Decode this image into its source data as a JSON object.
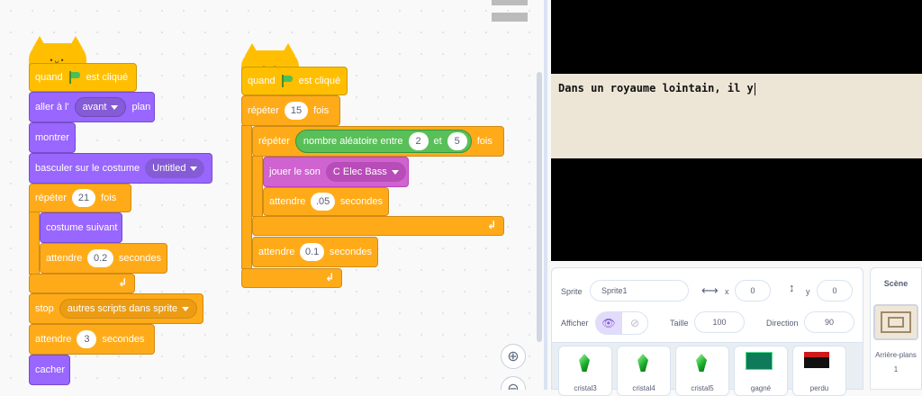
{
  "script1": {
    "hat_prefix": "quand",
    "hat_suffix": "est cliqué",
    "goto_prefix": "aller à l'",
    "goto_value": "avant",
    "goto_suffix": "plan",
    "show": "montrer",
    "switch_costume": "basculer sur le costume",
    "costume_value": "Untitled",
    "repeat_label": "répéter",
    "repeat_count": "21",
    "repeat_suffix": "fois",
    "next_costume": "costume suivant",
    "wait_label": "attendre",
    "wait_inner": "0.2",
    "wait_suffix": "secondes",
    "stop_label": "stop",
    "stop_value": "autres scripts dans sprite",
    "wait2": "3",
    "hide": "cacher"
  },
  "script2": {
    "hat_prefix": "quand",
    "hat_suffix": "est cliqué",
    "repeat_label": "répéter",
    "repeat_count": "15",
    "repeat_suffix": "fois",
    "inner_repeat_label": "répéter",
    "random_label": "nombre aléatoire entre",
    "random_from": "2",
    "random_and": "et",
    "random_to": "5",
    "inner_repeat_suffix": "fois",
    "play_label": "jouer le son",
    "sound_value": "C Elec Bass",
    "wait_label": "attendre",
    "wait_inner": ".05",
    "wait_suffix": "secondes",
    "wait_outer": "0.1"
  },
  "stage": {
    "text": "Dans un royaume lointain, il y"
  },
  "sprite_info": {
    "sprite_label": "Sprite",
    "sprite_name": "Sprite1",
    "x_label": "x",
    "x_value": "0",
    "y_label": "y",
    "y_value": "0",
    "show_label": "Afficher",
    "size_label": "Taille",
    "size_value": "100",
    "direction_label": "Direction",
    "direction_value": "90"
  },
  "sprites": [
    {
      "name": "cristal3"
    },
    {
      "name": "cristal4"
    },
    {
      "name": "cristal5"
    },
    {
      "name": "gagné"
    },
    {
      "name": "perdu"
    }
  ],
  "stage_panel": {
    "title": "Scène",
    "backdrops_label": "Arrière-plans",
    "backdrops_count": "1"
  },
  "colors": {
    "events": "#ffbf00",
    "control": "#ffab19",
    "looks": "#9966ff",
    "sound": "#cf63cf",
    "operators": "#59c059"
  }
}
